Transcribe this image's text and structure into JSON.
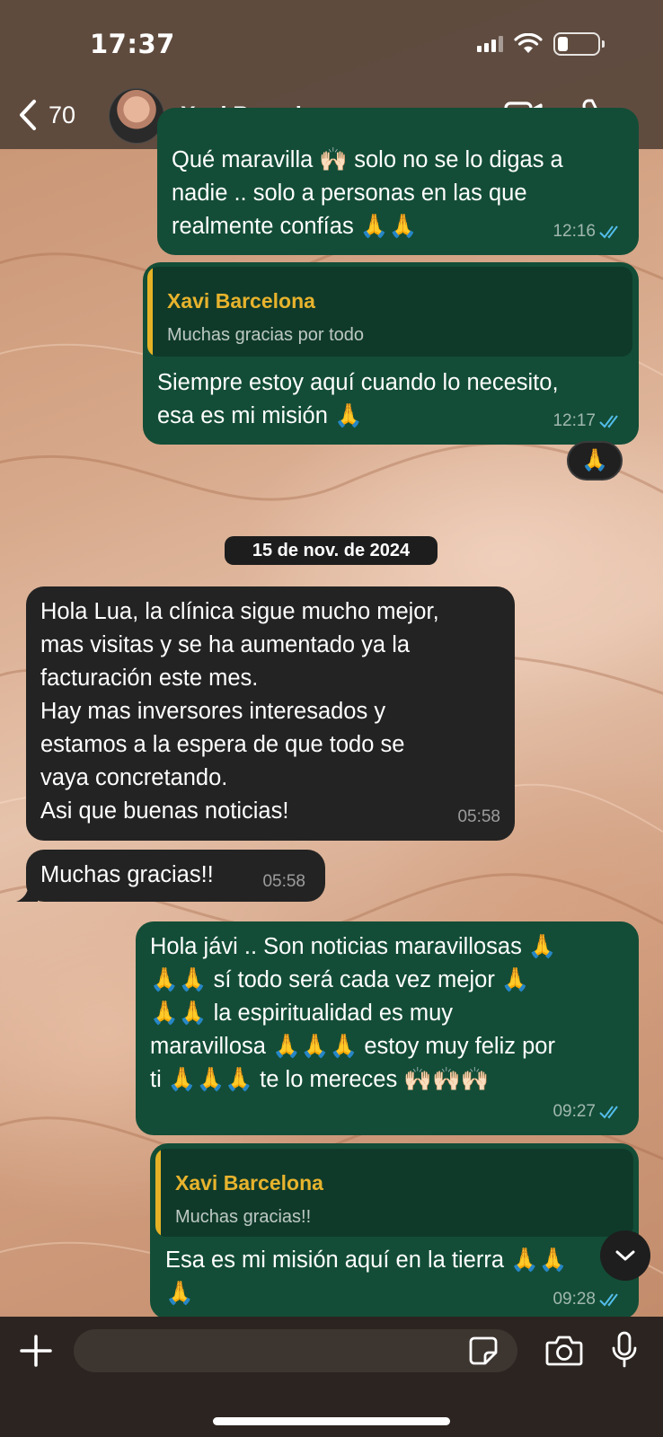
{
  "status_bar": {
    "time": "17:37",
    "battery_level": 0.25
  },
  "header": {
    "back_count": "70",
    "contact_name": "Xavi Barcelona",
    "icons": [
      "chevron-left-icon",
      "video-call-icon",
      "phone-icon"
    ]
  },
  "messages": [
    {
      "dir": "out",
      "text": "Qué maravilla 🙌🏻 solo no se lo digas a\nnadie .. solo a personas en las que\nrealmente confías 🙏🙏",
      "time": "12:16",
      "status": "read"
    },
    {
      "dir": "out",
      "quote_name": "Xavi Barcelona",
      "quote_text": "Muchas gracias por todo",
      "text": "Siempre estoy aquí cuando lo necesito,\nesa es mi misión 🙏",
      "time": "12:17",
      "status": "read",
      "reaction": "🙏"
    },
    {
      "dir": "in",
      "text": "Hola Lua, la clínica sigue mucho mejor,\nmas visitas y se ha aumentado ya la\nfacturación este mes.\nHay mas inversores interesados y\nestamos a la espera de que todo se\nvaya concretando.\nAsi que buenas noticias!",
      "time": "05:58"
    },
    {
      "dir": "in",
      "text": "Muchas gracias!!",
      "time": "05:58"
    },
    {
      "dir": "out",
      "text": "Hola jávi .. Son noticias maravillosas 🙏\n🙏🙏 sí todo será cada vez mejor 🙏\n🙏🙏 la espiritualidad es muy\nmaravillosa 🙏🙏🙏 estoy muy feliz por\nti 🙏🙏🙏 te lo mereces 🙌🏻🙌🏻🙌🏻",
      "time": "09:27",
      "status": "read"
    },
    {
      "dir": "out",
      "quote_name": "Xavi Barcelona",
      "quote_text": "Muchas gracias!!",
      "text": "Esa es mi misión aquí en la tierra 🙏🙏\n🙏",
      "time": "09:28",
      "status": "read"
    }
  ],
  "date_separator": "15 de nov. de 2024",
  "composer": {
    "placeholder": ""
  },
  "colors": {
    "outgoing_bubble": "#134d37",
    "incoming_bubble": "#232323",
    "quote_accent": "#e5b226",
    "read_ticks": "#53bdeb"
  }
}
